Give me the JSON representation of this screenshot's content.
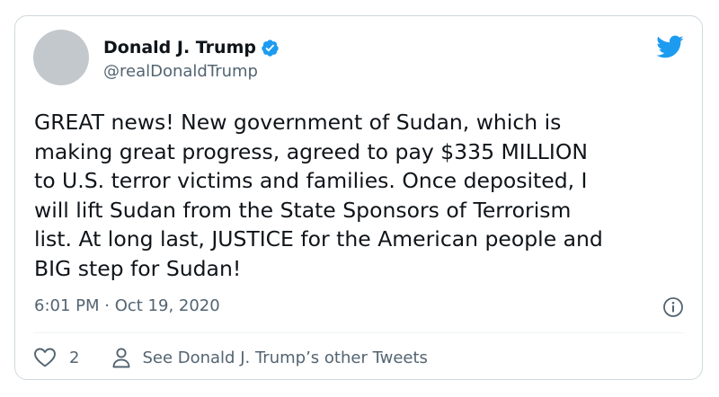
{
  "tweet": {
    "author": {
      "display_name": "Donald J. Trump",
      "handle": "@realDonaldTrump",
      "verified": true,
      "avatar_icon": "avatar-placeholder"
    },
    "text": "GREAT news! New government of Sudan, which is\nmaking great progress, agreed to pay $335 MILLION\nto U.S. terror victims and families. Once deposited, I\nwill lift Sudan from the State Sponsors of Terrorism\nlist. At long last, JUSTICE for the American people and\nBIG step for Sudan!",
    "timestamp": "6:01 PM · Oct 19, 2020",
    "likes": "2",
    "see_other_label": "See Donald J. Trump’s other Tweets"
  },
  "icons": {
    "brand": "twitter-bird-icon",
    "verified": "verified-badge-icon",
    "info": "info-icon",
    "like": "heart-icon",
    "profile": "person-icon"
  },
  "colors": {
    "twitter_blue": "#1d9bf0",
    "text_primary": "#0f1419",
    "text_secondary": "#536471",
    "border": "#cfd9de"
  }
}
